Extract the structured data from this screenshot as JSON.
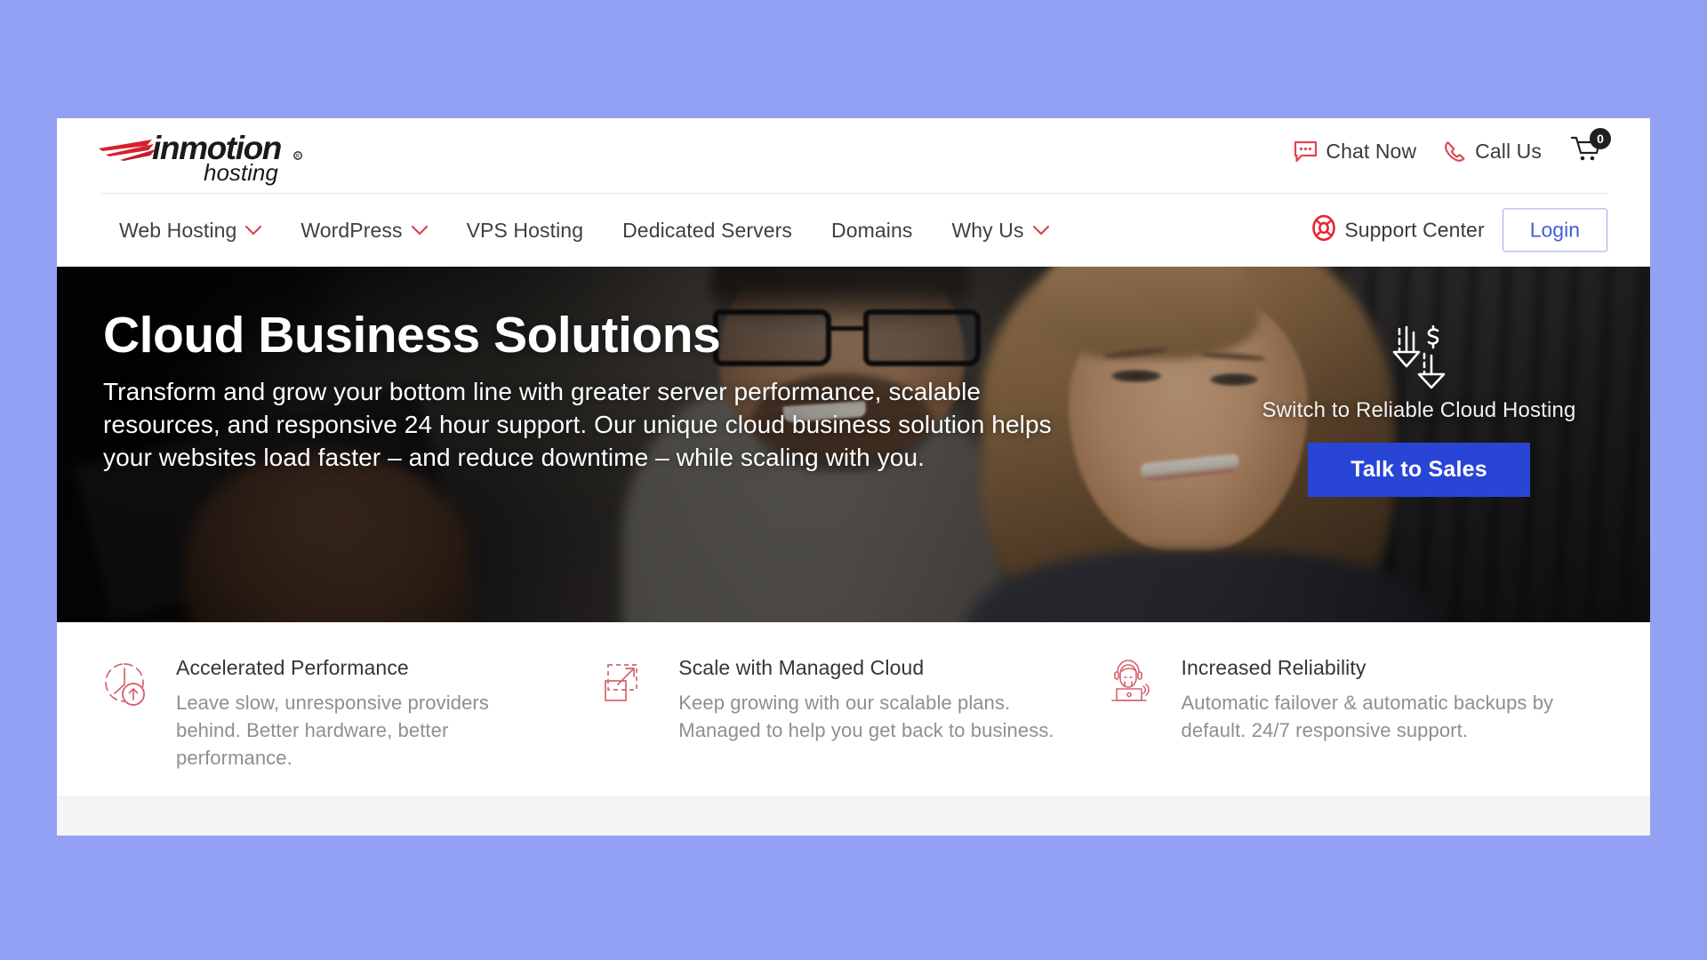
{
  "brand": {
    "name_primary": "inmotion",
    "name_secondary": "hosting",
    "registered_mark": "®",
    "accent_red": "#d6202e",
    "logo_text_color": "#1a1a1a"
  },
  "topbar": {
    "chat": {
      "label": "Chat Now",
      "icon": "chat-bubble-icon",
      "icon_color": "#e0454f"
    },
    "call": {
      "label": "Call Us",
      "icon": "phone-icon",
      "icon_color": "#e0454f"
    },
    "cart": {
      "icon": "shopping-cart-icon",
      "badge_count": "0",
      "badge_bg": "#231f20"
    }
  },
  "nav": {
    "items": [
      {
        "label": "Web Hosting",
        "has_dropdown": true
      },
      {
        "label": "WordPress",
        "has_dropdown": true
      },
      {
        "label": "VPS Hosting",
        "has_dropdown": false
      },
      {
        "label": "Dedicated Servers",
        "has_dropdown": false
      },
      {
        "label": "Domains",
        "has_dropdown": false
      },
      {
        "label": "Why Us",
        "has_dropdown": true
      }
    ],
    "support": {
      "label": "Support Center",
      "icon": "life-ring-icon",
      "icon_color": "#e8252f"
    },
    "login": {
      "label": "Login",
      "text_color": "#3f5fd6",
      "border_color": "#9aa8e8"
    },
    "chevron_color": "#d9414d"
  },
  "hero": {
    "title": "Cloud Business Solutions",
    "subtitle": "Transform and grow your bottom line with greater server performance, scalable resources, and responsive 24 hour support. Our unique cloud business solution helps your websites load faster – and reduce downtime – while scaling with you.",
    "cta": {
      "icon": "cost-savings-down-arrow-dollar-icon",
      "tagline": "Switch to Reliable Cloud Hosting",
      "button_label": "Talk to Sales",
      "button_bg": "#2945d6",
      "button_text_color": "#ffffff"
    }
  },
  "features": [
    {
      "icon": "clock-speed-up-icon",
      "title": "Accelerated Performance",
      "description": "Leave slow, unresponsive providers behind. Better hardware, better performance."
    },
    {
      "icon": "scale-expand-arrow-icon",
      "title": "Scale with Managed Cloud",
      "description": "Keep growing with our scalable plans. Managed to help you get back to business."
    },
    {
      "icon": "support-agent-laptop-icon",
      "title": "Increased Reliability",
      "description": "Automatic failover & automatic backups by default. 24/7 responsive support."
    }
  ],
  "theme": {
    "feature_icon_color": "#d4636f",
    "page_bg": "#93a1f5"
  }
}
